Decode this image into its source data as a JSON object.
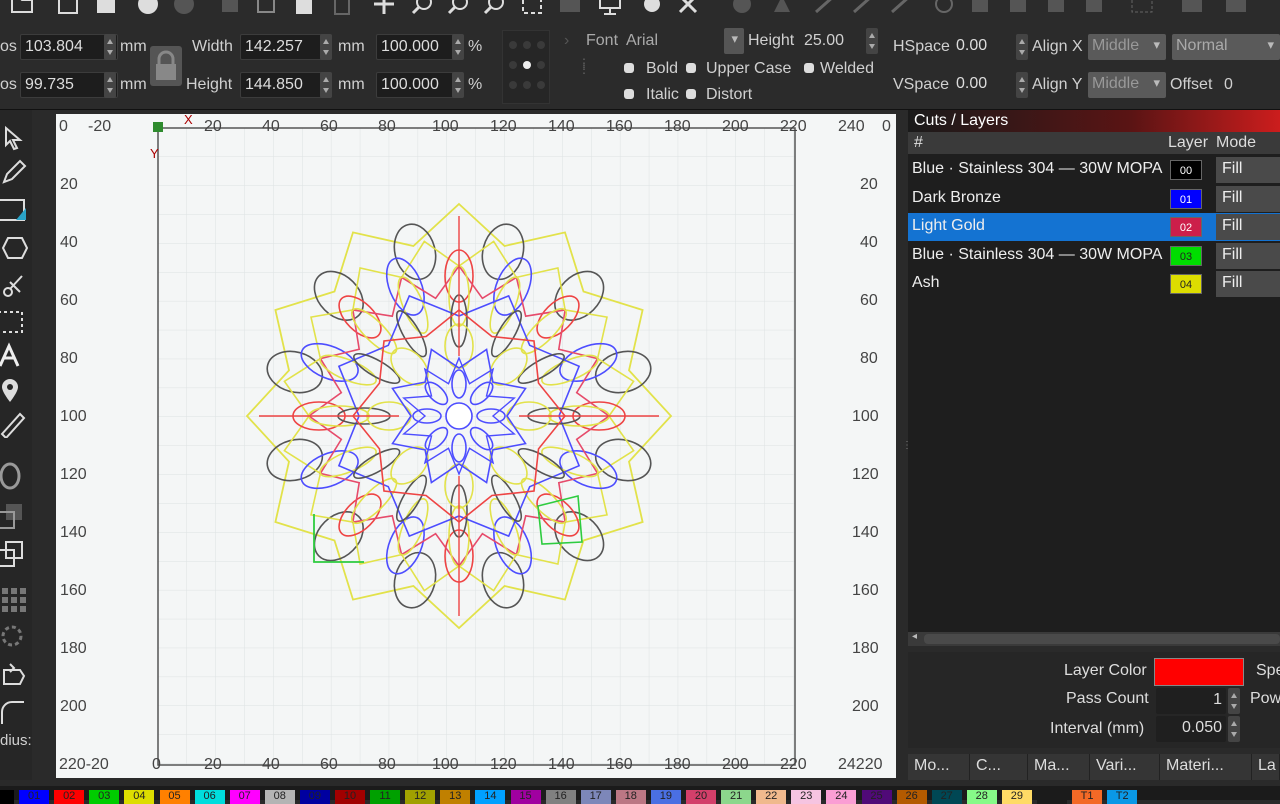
{
  "props": {
    "xpos_label": "os",
    "xpos_value": "103.804",
    "xpos_unit": "mm",
    "ypos_label": "os",
    "ypos_value": "99.735",
    "ypos_unit": "mm",
    "width_label": "Width",
    "width_value": "142.257",
    "width_unit": "mm",
    "height_label": "Height",
    "height_value": "144.850",
    "height_unit": "mm",
    "scale_w_value": "100.000",
    "scale_w_unit": "%",
    "scale_h_value": "100.000",
    "scale_h_unit": "%",
    "font_label": "Font",
    "font_value": "Arial",
    "text_height_label": "Height",
    "text_height_value": "25.00",
    "bold_label": "Bold",
    "italic_label": "Italic",
    "upper_case_label": "Upper Case",
    "distort_label": "Distort",
    "welded_label": "Welded",
    "hspace_label": "HSpace",
    "hspace_value": "0.00",
    "vspace_label": "VSpace",
    "vspace_value": "0.00",
    "alignx_label": "Align X",
    "alignx_value": "Middle",
    "aligny_label": "Align Y",
    "aligny_value": "Middle",
    "normal_value": "Normal",
    "offset_label": "Offset",
    "offset_value": "0"
  },
  "ruler": {
    "top": [
      "0",
      "-20",
      "20",
      "40",
      "60",
      "80",
      "100",
      "120",
      "140",
      "160",
      "180",
      "200",
      "220",
      "240"
    ],
    "left": [
      "20",
      "40",
      "60",
      "80",
      "100",
      "120",
      "140",
      "160",
      "180",
      "200"
    ],
    "bottom_corner_left": "220-20",
    "bottom": [
      "0",
      "20",
      "40",
      "60",
      "80",
      "100",
      "120",
      "140",
      "160",
      "180",
      "200",
      "220"
    ],
    "bottom_corner_right": "24220",
    "right_top": "0",
    "x_marker": "X",
    "y_marker": "Y"
  },
  "left_tools_label": "dius:",
  "cuts": {
    "title": "Cuts / Layers",
    "col_hash": "#",
    "col_layer": "Layer",
    "col_mode": "Mode",
    "rows": [
      {
        "name": "Blue · Stainless 304 — 30W MOPA",
        "layer": "00",
        "color": "#000000",
        "text_color": "#ffffff",
        "mode": "Fill",
        "selected": false
      },
      {
        "name": "Dark Bronze",
        "layer": "01",
        "color": "#0000ff",
        "text_color": "#ffffff",
        "mode": "Fill",
        "selected": false
      },
      {
        "name": "Light Gold",
        "layer": "02",
        "color": "#cc1f4a",
        "text_color": "#ffffff",
        "mode": "Fill",
        "selected": true
      },
      {
        "name": "Blue · Stainless 304 — 30W MOPA",
        "layer": "03",
        "color": "#00dd00",
        "text_color": "#222222",
        "mode": "Fill",
        "selected": false
      },
      {
        "name": "Ash",
        "layer": "04",
        "color": "#dddd00",
        "text_color": "#222222",
        "mode": "Fill",
        "selected": false
      }
    ]
  },
  "layer_props": {
    "layer_color_label": "Layer Color",
    "layer_color": "#ff0000",
    "speed_label": "Spe",
    "pass_count_label": "Pass Count",
    "pass_count_value": "1",
    "power_label": "Pow",
    "interval_label": "Interval (mm)",
    "interval_value": "0.050"
  },
  "tabs": [
    "Mo...",
    "C...",
    "Ma...",
    "Vari...",
    "Materi...",
    "La"
  ],
  "palette": [
    {
      "label": "",
      "color": "#000000"
    },
    {
      "label": "01",
      "color": "#0000ff"
    },
    {
      "label": "02",
      "color": "#ff0000"
    },
    {
      "label": "03",
      "color": "#00cc00"
    },
    {
      "label": "04",
      "color": "#dddd00"
    },
    {
      "label": "05",
      "color": "#ff8000"
    },
    {
      "label": "06",
      "color": "#00dddd"
    },
    {
      "label": "07",
      "color": "#ff00ff"
    },
    {
      "label": "08",
      "color": "#b4b4b4"
    },
    {
      "label": "09",
      "color": "#0000a0"
    },
    {
      "label": "10",
      "color": "#a00000"
    },
    {
      "label": "11",
      "color": "#00a000"
    },
    {
      "label": "12",
      "color": "#a0a000"
    },
    {
      "label": "13",
      "color": "#c08000"
    },
    {
      "label": "14",
      "color": "#00a0ff"
    },
    {
      "label": "15",
      "color": "#a000a0"
    },
    {
      "label": "16",
      "color": "#808080"
    },
    {
      "label": "17",
      "color": "#7d87b9"
    },
    {
      "label": "18",
      "color": "#bb7784"
    },
    {
      "label": "19",
      "color": "#4a6fe3"
    },
    {
      "label": "20",
      "color": "#d33f6a"
    },
    {
      "label": "21",
      "color": "#8cd78c"
    },
    {
      "label": "22",
      "color": "#f0b98d"
    },
    {
      "label": "23",
      "color": "#f6c4e1"
    },
    {
      "label": "24",
      "color": "#fa9ed4"
    },
    {
      "label": "25",
      "color": "#500a78"
    },
    {
      "label": "26",
      "color": "#b45a00"
    },
    {
      "label": "27",
      "color": "#004754"
    },
    {
      "label": "28",
      "color": "#86fa88"
    },
    {
      "label": "29",
      "color": "#ffdb66"
    },
    {
      "label": "",
      "color": "#1b1b1b"
    },
    {
      "label": "T1",
      "color": "#f36926"
    },
    {
      "label": "T2",
      "color": "#0a98e6"
    }
  ],
  "colors": {
    "accent_selected": "#1473d2",
    "canvas_bg": "#f4f6f6"
  }
}
